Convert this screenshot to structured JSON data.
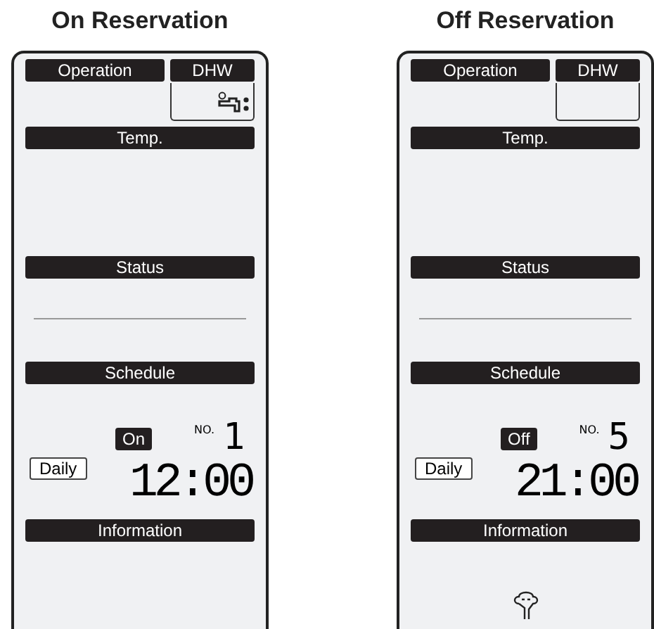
{
  "panels": [
    {
      "title": "On Reservation",
      "operation": "Operation",
      "dhw": "DHW",
      "faucet_icon": true,
      "temp": "Temp.",
      "status": "Status",
      "schedule": "Schedule",
      "mode": "On",
      "no_label": "NO.",
      "no_value": "1",
      "repeat": "Daily",
      "time": "12:00",
      "information": "Information",
      "hand_icon": false
    },
    {
      "title": "Off Reservation",
      "operation": "Operation",
      "dhw": "DHW",
      "faucet_icon": false,
      "temp": "Temp.",
      "status": "Status",
      "schedule": "Schedule",
      "mode": "Off",
      "no_label": "NO.",
      "no_value": "5",
      "repeat": "Daily",
      "time": "21:00",
      "information": "Information",
      "hand_icon": true
    }
  ]
}
